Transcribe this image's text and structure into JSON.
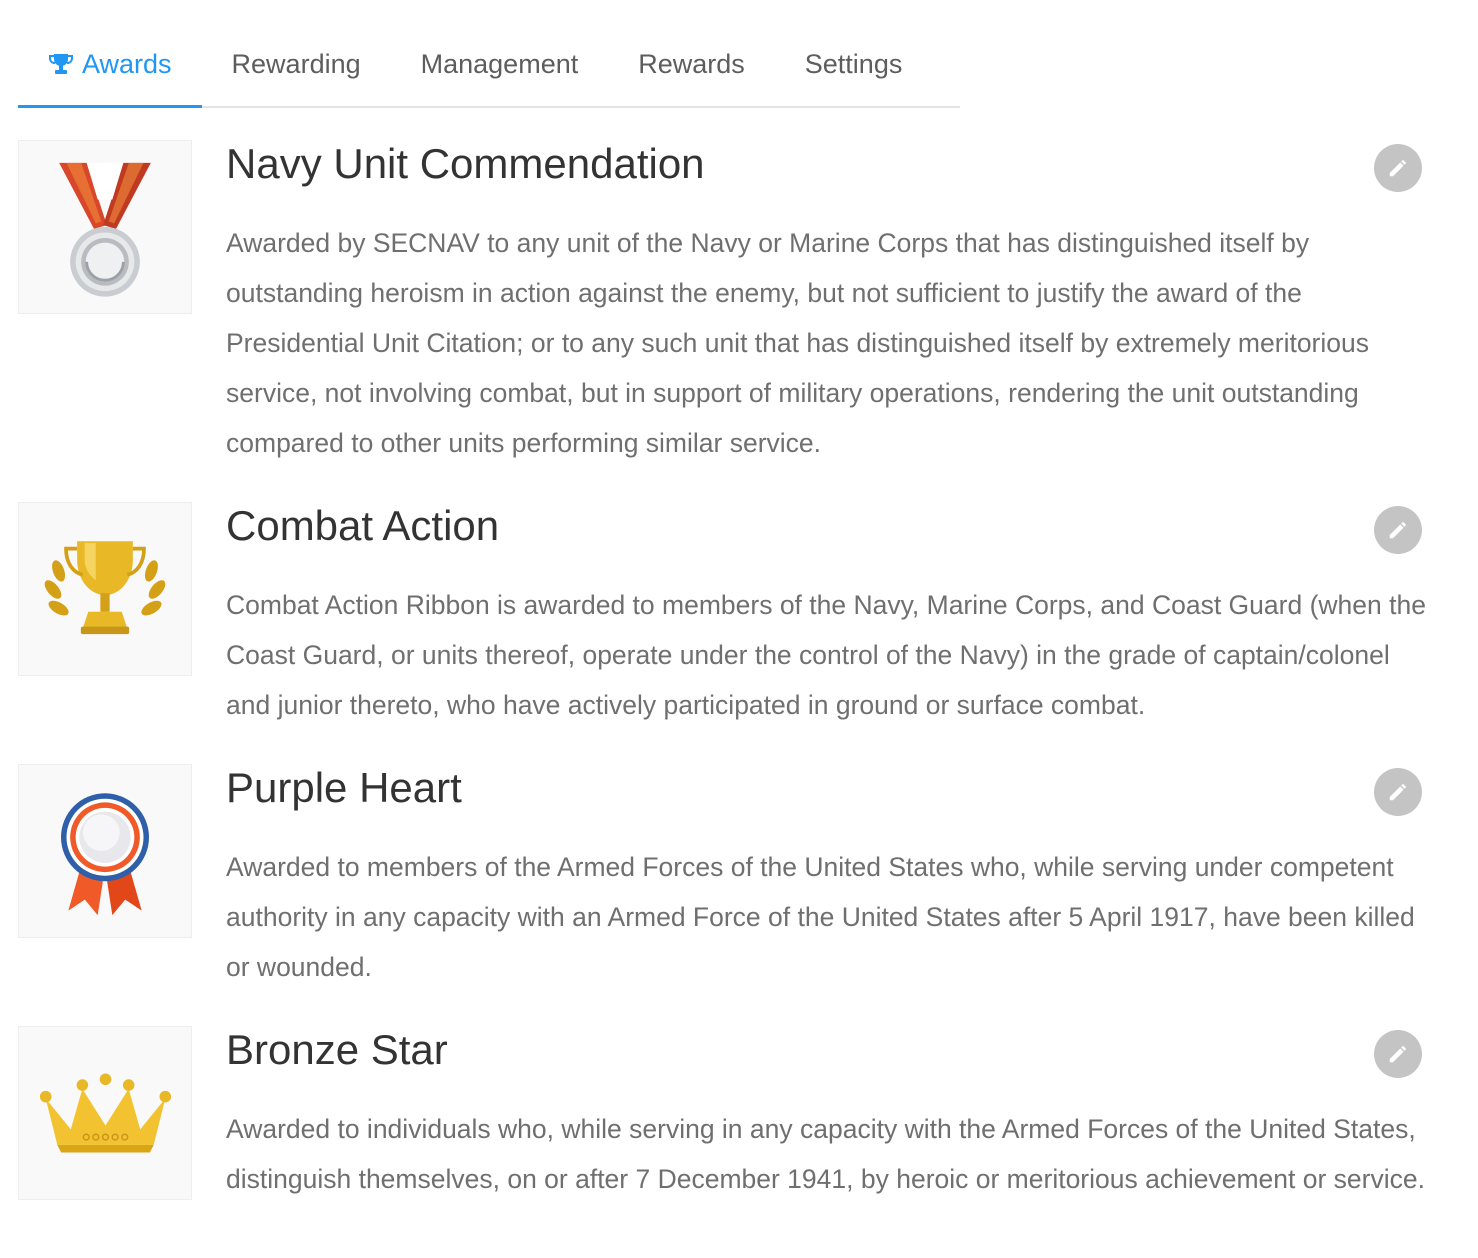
{
  "tabs": [
    {
      "label": "Awards",
      "icon": "trophy-icon",
      "active": true
    },
    {
      "label": "Rewarding",
      "active": false
    },
    {
      "label": "Management",
      "active": false
    },
    {
      "label": "Rewards",
      "active": false
    },
    {
      "label": "Settings",
      "active": false
    }
  ],
  "colors": {
    "accent": "#2196f3",
    "edit_button": "#c4c4c4",
    "title_text": "#333333",
    "body_text": "#6f6f6f"
  },
  "awards": [
    {
      "title": "Navy Unit Commendation",
      "image": "silver-medal-icon",
      "description": "Awarded by SECNAV to any unit of the Navy or Marine Corps that has distinguished itself by outstanding heroism in action against the enemy, but not sufficient to justify the award of the Presidential Unit Citation; or to any such unit that has distinguished itself by extremely meritorious service, not involving combat, but in support of military operations, rendering the unit outstanding compared to other units performing similar service."
    },
    {
      "title": "Combat Action",
      "image": "gold-trophy-icon",
      "description": "Combat Action Ribbon is awarded to members of the Navy, Marine Corps, and Coast Guard (when the Coast Guard, or units thereof, operate under the control of the Navy) in the grade of captain/colonel and junior thereto, who have actively participated in ground or surface combat."
    },
    {
      "title": "Purple Heart",
      "image": "rosette-ribbon-icon",
      "description": "Awarded to members of the Armed Forces of the United States who, while serving under competent authority in any capacity with an Armed Force of the United States after 5 April 1917, have been killed or wounded."
    },
    {
      "title": "Bronze Star",
      "image": "gold-crown-icon",
      "description": "Awarded to individuals who, while serving in any capacity with the Armed Forces of the United States, distinguish themselves, on or after 7 December 1941, by heroic or meritorious achievement or service."
    }
  ]
}
